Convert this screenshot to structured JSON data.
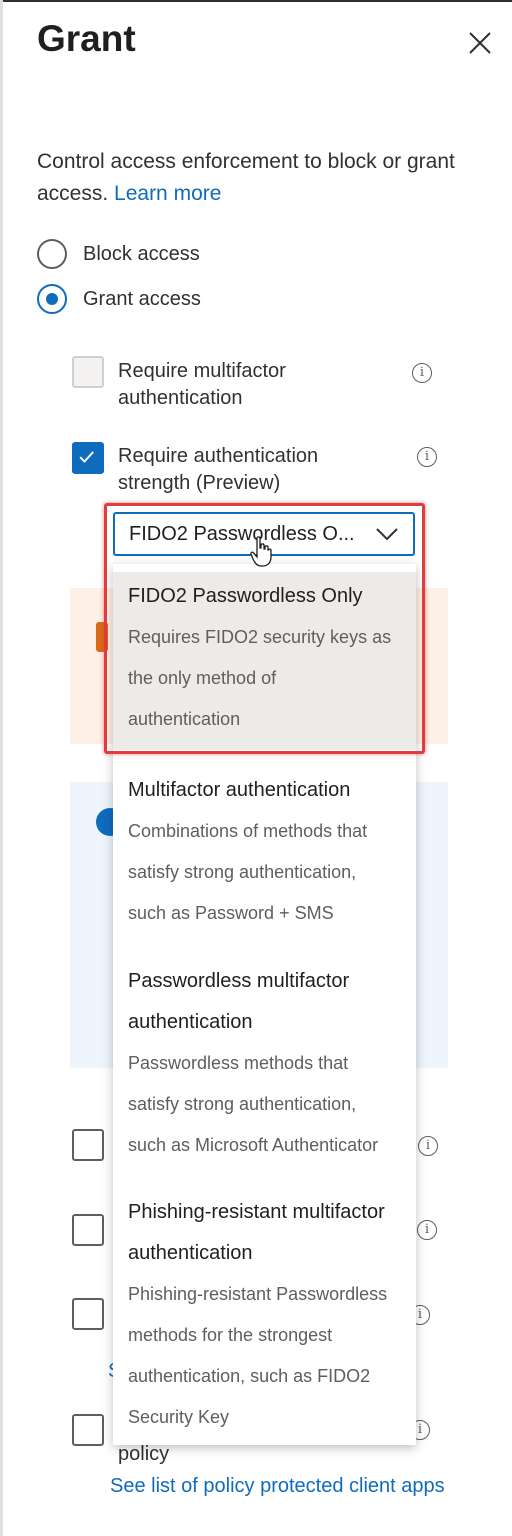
{
  "panel": {
    "title": "Grant",
    "close_label": "×"
  },
  "intro": {
    "text": "Control access enforcement to block or grant access. ",
    "link": "Learn more"
  },
  "access": {
    "block_label": "Block access",
    "grant_label": "Grant access",
    "selected": "grant"
  },
  "requirements": {
    "mfa_label": "Require multifactor authentication",
    "mfa_checked": false,
    "strength_label": "Require authentication strength (Preview)",
    "strength_checked": true,
    "info_glyph": "i"
  },
  "strength_dropdown": {
    "value": "FIDO2 Passwordless O...",
    "options": [
      {
        "title": "FIDO2 Passwordless Only",
        "description": [
          "Requires FIDO2 security keys as",
          "the only method of",
          "authentication"
        ]
      },
      {
        "title": "Multifactor authentication",
        "description": [
          "Combinations of methods that",
          "satisfy strong authentication,",
          "such as Password + SMS"
        ]
      },
      {
        "title": "Passwordless multifactor authentication",
        "title_lines": [
          "Passwordless multifactor",
          "authentication"
        ],
        "description": [
          "Passwordless methods that",
          "satisfy strong authentication,",
          "such as Microsoft Authenticator"
        ]
      },
      {
        "title": "Phishing-resistant multifactor authentication",
        "title_lines": [
          "Phishing-resistant multifactor",
          "authentication"
        ],
        "description": [
          "Phishing-resistant Passwordless",
          "methods for the strongest",
          "authentication, such as FIDO2",
          "Security Key"
        ]
      }
    ]
  },
  "tail": {
    "policy_label": "policy",
    "client_apps_link": "See list of policy protected client apps",
    "peek_link_char": "S"
  },
  "colors": {
    "accent": "#0f6cbd",
    "highlight": "#e03c3c",
    "warning": "#d86a16",
    "selected_bg": "#edebe9"
  },
  "icons": {
    "close": "close-icon",
    "chevron": "chevron-down-icon",
    "info": "info-icon",
    "check": "checkmark-icon",
    "cursor": "hand-pointer-icon"
  }
}
